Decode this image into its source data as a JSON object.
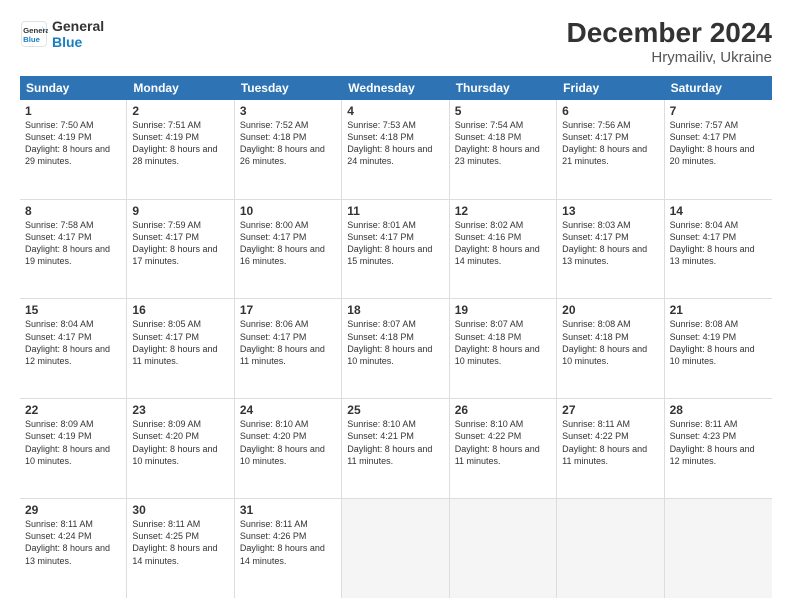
{
  "header": {
    "logo_line1": "General",
    "logo_line2": "Blue",
    "title": "December 2024",
    "subtitle": "Hrymailiv, Ukraine"
  },
  "days_of_week": [
    "Sunday",
    "Monday",
    "Tuesday",
    "Wednesday",
    "Thursday",
    "Friday",
    "Saturday"
  ],
  "weeks": [
    [
      {
        "day": 1,
        "sunrise": "7:50 AM",
        "sunset": "4:19 PM",
        "daylight": "8 hours and 29 minutes."
      },
      {
        "day": 2,
        "sunrise": "7:51 AM",
        "sunset": "4:19 PM",
        "daylight": "8 hours and 28 minutes."
      },
      {
        "day": 3,
        "sunrise": "7:52 AM",
        "sunset": "4:18 PM",
        "daylight": "8 hours and 26 minutes."
      },
      {
        "day": 4,
        "sunrise": "7:53 AM",
        "sunset": "4:18 PM",
        "daylight": "8 hours and 24 minutes."
      },
      {
        "day": 5,
        "sunrise": "7:54 AM",
        "sunset": "4:18 PM",
        "daylight": "8 hours and 23 minutes."
      },
      {
        "day": 6,
        "sunrise": "7:56 AM",
        "sunset": "4:17 PM",
        "daylight": "8 hours and 21 minutes."
      },
      {
        "day": 7,
        "sunrise": "7:57 AM",
        "sunset": "4:17 PM",
        "daylight": "8 hours and 20 minutes."
      }
    ],
    [
      {
        "day": 8,
        "sunrise": "7:58 AM",
        "sunset": "4:17 PM",
        "daylight": "8 hours and 19 minutes."
      },
      {
        "day": 9,
        "sunrise": "7:59 AM",
        "sunset": "4:17 PM",
        "daylight": "8 hours and 17 minutes."
      },
      {
        "day": 10,
        "sunrise": "8:00 AM",
        "sunset": "4:17 PM",
        "daylight": "8 hours and 16 minutes."
      },
      {
        "day": 11,
        "sunrise": "8:01 AM",
        "sunset": "4:17 PM",
        "daylight": "8 hours and 15 minutes."
      },
      {
        "day": 12,
        "sunrise": "8:02 AM",
        "sunset": "4:16 PM",
        "daylight": "8 hours and 14 minutes."
      },
      {
        "day": 13,
        "sunrise": "8:03 AM",
        "sunset": "4:17 PM",
        "daylight": "8 hours and 13 minutes."
      },
      {
        "day": 14,
        "sunrise": "8:04 AM",
        "sunset": "4:17 PM",
        "daylight": "8 hours and 13 minutes."
      }
    ],
    [
      {
        "day": 15,
        "sunrise": "8:04 AM",
        "sunset": "4:17 PM",
        "daylight": "8 hours and 12 minutes."
      },
      {
        "day": 16,
        "sunrise": "8:05 AM",
        "sunset": "4:17 PM",
        "daylight": "8 hours and 11 minutes."
      },
      {
        "day": 17,
        "sunrise": "8:06 AM",
        "sunset": "4:17 PM",
        "daylight": "8 hours and 11 minutes."
      },
      {
        "day": 18,
        "sunrise": "8:07 AM",
        "sunset": "4:18 PM",
        "daylight": "8 hours and 10 minutes."
      },
      {
        "day": 19,
        "sunrise": "8:07 AM",
        "sunset": "4:18 PM",
        "daylight": "8 hours and 10 minutes."
      },
      {
        "day": 20,
        "sunrise": "8:08 AM",
        "sunset": "4:18 PM",
        "daylight": "8 hours and 10 minutes."
      },
      {
        "day": 21,
        "sunrise": "8:08 AM",
        "sunset": "4:19 PM",
        "daylight": "8 hours and 10 minutes."
      }
    ],
    [
      {
        "day": 22,
        "sunrise": "8:09 AM",
        "sunset": "4:19 PM",
        "daylight": "8 hours and 10 minutes."
      },
      {
        "day": 23,
        "sunrise": "8:09 AM",
        "sunset": "4:20 PM",
        "daylight": "8 hours and 10 minutes."
      },
      {
        "day": 24,
        "sunrise": "8:10 AM",
        "sunset": "4:20 PM",
        "daylight": "8 hours and 10 minutes."
      },
      {
        "day": 25,
        "sunrise": "8:10 AM",
        "sunset": "4:21 PM",
        "daylight": "8 hours and 11 minutes."
      },
      {
        "day": 26,
        "sunrise": "8:10 AM",
        "sunset": "4:22 PM",
        "daylight": "8 hours and 11 minutes."
      },
      {
        "day": 27,
        "sunrise": "8:11 AM",
        "sunset": "4:22 PM",
        "daylight": "8 hours and 11 minutes."
      },
      {
        "day": 28,
        "sunrise": "8:11 AM",
        "sunset": "4:23 PM",
        "daylight": "8 hours and 12 minutes."
      }
    ],
    [
      {
        "day": 29,
        "sunrise": "8:11 AM",
        "sunset": "4:24 PM",
        "daylight": "8 hours and 13 minutes."
      },
      {
        "day": 30,
        "sunrise": "8:11 AM",
        "sunset": "4:25 PM",
        "daylight": "8 hours and 14 minutes."
      },
      {
        "day": 31,
        "sunrise": "8:11 AM",
        "sunset": "4:26 PM",
        "daylight": "8 hours and 14 minutes."
      },
      null,
      null,
      null,
      null
    ]
  ]
}
